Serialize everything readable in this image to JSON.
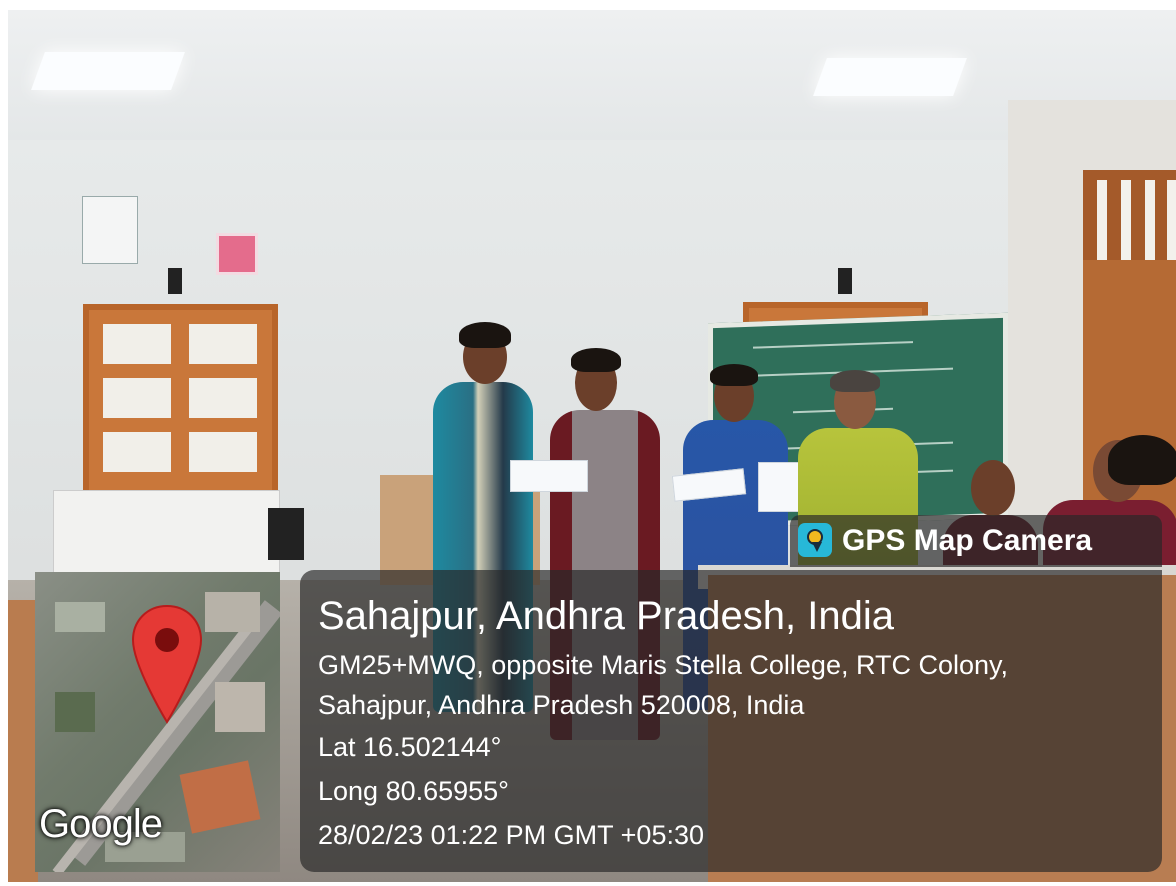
{
  "app_tag": {
    "name": "GPS Map Camera",
    "icon": "map-pin-app-icon"
  },
  "map": {
    "logo": "Google",
    "pin_icon": "map-pin-icon",
    "pin_color": "#e53935"
  },
  "location": {
    "place": "Sahajpur, Andhra Pradesh, India",
    "address_line1": "GM25+MWQ, opposite Maris Stella College, RTC Colony,",
    "address_line2": "Sahajpur, Andhra Pradesh 520008, India",
    "latitude": "Lat 16.502144°",
    "longitude": "Long 80.65955°",
    "datetime": "28/02/23 01:22 PM GMT +05:30"
  },
  "overlay_color": "#282828"
}
